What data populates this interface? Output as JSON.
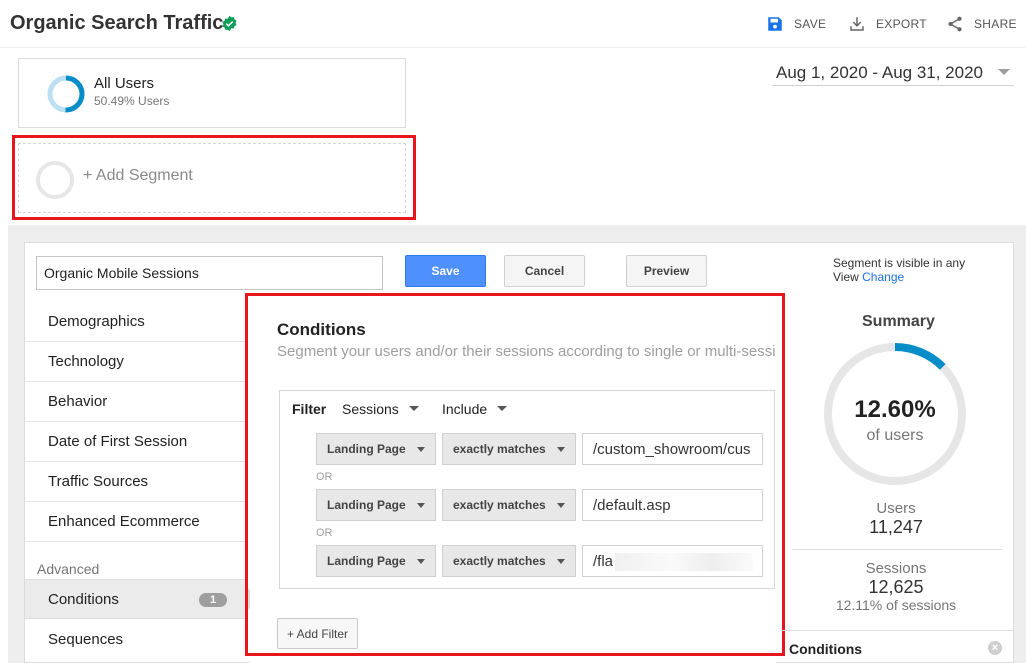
{
  "header": {
    "title": "Organic Search Traffic",
    "actions": {
      "save": "SAVE",
      "export": "EXPORT",
      "share": "SHARE"
    }
  },
  "segments": {
    "active": {
      "name": "All Users",
      "sub": "50.49% Users",
      "share_fraction": 0.5049
    },
    "add_label": "+ Add Segment"
  },
  "date_range": "Aug 1, 2020 - Aug 31, 2020",
  "editor": {
    "segment_name": "Organic Mobile Sessions",
    "buttons": {
      "save": "Save",
      "cancel": "Cancel",
      "preview": "Preview"
    },
    "visibility": {
      "text": "Segment is visible in any View",
      "link": "Change"
    },
    "nav": {
      "items": [
        "Demographics",
        "Technology",
        "Behavior",
        "Date of First Session",
        "Traffic Sources",
        "Enhanced Ecommerce"
      ],
      "advanced_label": "Advanced",
      "conditions": "Conditions",
      "conditions_count": "1",
      "sequences": "Sequences"
    },
    "conditions": {
      "title": "Conditions",
      "description": "Segment your users and/or their sessions according to single or multi-session conditions.",
      "filter_label": "Filter",
      "scope": "Sessions",
      "mode": "Include",
      "or_label": "OR",
      "rows": [
        {
          "dimension": "Landing Page",
          "operator": "exactly matches",
          "value": "/custom_showroom/cus"
        },
        {
          "dimension": "Landing Page",
          "operator": "exactly matches",
          "value": "/default.asp"
        },
        {
          "dimension": "Landing Page",
          "operator": "exactly matches",
          "value": "/fla"
        }
      ],
      "add_filter": "+ Add Filter"
    },
    "summary": {
      "title": "Summary",
      "percent": "12.60%",
      "percent_sub": "of users",
      "percent_fraction": 0.126,
      "users_label": "Users",
      "users_value": "11,247",
      "sessions_label": "Sessions",
      "sessions_value": "12,625",
      "sessions_sub": "12.11% of sessions",
      "conditions_label": "Conditions"
    }
  },
  "colors": {
    "accent_blue": "#058dc7",
    "donut_track": "#e6e6e6",
    "highlight_red": "#e8161c",
    "verified_green": "#0f9d58",
    "save_blue": "#4d90fe"
  }
}
